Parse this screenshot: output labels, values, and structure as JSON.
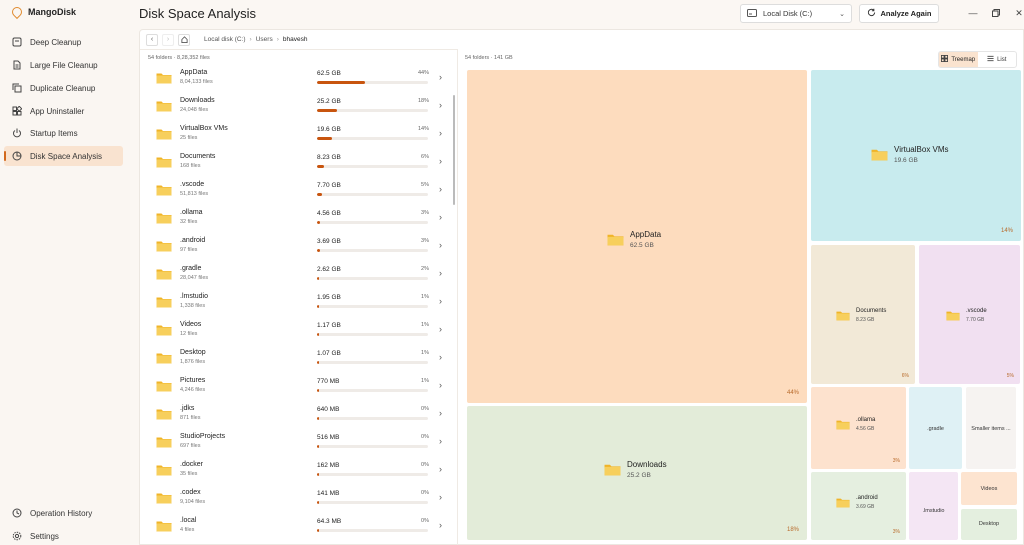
{
  "app": {
    "name": "MangoDisk"
  },
  "sidebar": {
    "items": [
      {
        "label": "Deep Cleanup",
        "icon": "broom-icon"
      },
      {
        "label": "Large File Cleanup",
        "icon": "file-icon"
      },
      {
        "label": "Duplicate Cleanup",
        "icon": "copy-icon"
      },
      {
        "label": "App Uninstaller",
        "icon": "apps-icon"
      },
      {
        "label": "Startup Items",
        "icon": "power-icon"
      },
      {
        "label": "Disk Space Analysis",
        "icon": "pie-chart-icon",
        "active": true
      }
    ],
    "footer": [
      {
        "label": "Operation History",
        "icon": "history-icon"
      },
      {
        "label": "Settings",
        "icon": "gear-icon"
      }
    ]
  },
  "header": {
    "title": "Disk Space Analysis",
    "drive": "Local Disk (C:)",
    "analyze_label": "Analyze Again"
  },
  "breadcrumb": [
    "Local disk (C:)",
    "Users",
    "bhavesh"
  ],
  "list": {
    "summary": "54 folders · 8,28,352 files",
    "rows": [
      {
        "name": "AppData",
        "files": "8,04,133 files",
        "size": "62.5 GB",
        "pct": "44%",
        "pct_value": 44
      },
      {
        "name": "Downloads",
        "files": "24,048 files",
        "size": "25.2 GB",
        "pct": "18%",
        "pct_value": 18
      },
      {
        "name": "VirtualBox VMs",
        "files": "25 files",
        "size": "19.6 GB",
        "pct": "14%",
        "pct_value": 14
      },
      {
        "name": "Documents",
        "files": "168 files",
        "size": "8.23 GB",
        "pct": "6%",
        "pct_value": 6
      },
      {
        "name": ".vscode",
        "files": "51,813 files",
        "size": "7.70 GB",
        "pct": "5%",
        "pct_value": 5
      },
      {
        "name": ".ollama",
        "files": "32 files",
        "size": "4.56 GB",
        "pct": "3%",
        "pct_value": 3
      },
      {
        "name": ".android",
        "files": "97 files",
        "size": "3.69 GB",
        "pct": "3%",
        "pct_value": 3
      },
      {
        "name": ".gradle",
        "files": "28,047 files",
        "size": "2.62 GB",
        "pct": "2%",
        "pct_value": 2
      },
      {
        "name": ".lmstudio",
        "files": "1,338 files",
        "size": "1.95 GB",
        "pct": "1%",
        "pct_value": 1
      },
      {
        "name": "Videos",
        "files": "12 files",
        "size": "1.17 GB",
        "pct": "1%",
        "pct_value": 1
      },
      {
        "name": "Desktop",
        "files": "1,876 files",
        "size": "1.07 GB",
        "pct": "1%",
        "pct_value": 1
      },
      {
        "name": "Pictures",
        "files": "4,246 files",
        "size": "770 MB",
        "pct": "1%",
        "pct_value": 1
      },
      {
        "name": ".jdks",
        "files": "871 files",
        "size": "640 MB",
        "pct": "0%",
        "pct_value": 0.4
      },
      {
        "name": "StudioProjects",
        "files": "697 files",
        "size": "516 MB",
        "pct": "0%",
        "pct_value": 0.3
      },
      {
        "name": ".docker",
        "files": "35 files",
        "size": "162 MB",
        "pct": "0%",
        "pct_value": 0.1
      },
      {
        "name": ".codex",
        "files": "9,104 files",
        "size": "141 MB",
        "pct": "0%",
        "pct_value": 0.1
      },
      {
        "name": ".local",
        "files": "4 files",
        "size": "64.3 MB",
        "pct": "0%",
        "pct_value": 0.05
      }
    ]
  },
  "treemap": {
    "summary": "54 folders · 141 GB",
    "view_options": {
      "treemap": "Treemap",
      "list": "List",
      "active": "treemap"
    },
    "tiles": [
      {
        "id": "appdata",
        "name": "AppData",
        "size": "62.5 GB",
        "pct": "44%",
        "color": "#fddcbe"
      },
      {
        "id": "downloads",
        "name": "Downloads",
        "size": "25.2 GB",
        "pct": "18%",
        "color": "#e3ecd9"
      },
      {
        "id": "virtualbox",
        "name": "VirtualBox VMs",
        "size": "19.6 GB",
        "pct": "14%",
        "color": "#c8ebee"
      },
      {
        "id": "documents",
        "name": "Documents",
        "size": "8.23 GB",
        "pct": "6%",
        "color": "#f2e9d7"
      },
      {
        "id": "vscode",
        "name": ".vscode",
        "size": "7.70 GB",
        "pct": "5%",
        "color": "#f1e0f1"
      },
      {
        "id": "ollama",
        "name": ".ollama",
        "size": "4.56 GB",
        "pct": "3%",
        "color": "#fde2ce"
      },
      {
        "id": "android",
        "name": ".android",
        "size": "3.69 GB",
        "pct": "3%",
        "color": "#e5efe0"
      },
      {
        "id": "gradle",
        "name": ".gradle",
        "color": "#dff1f5"
      },
      {
        "id": "smaller",
        "name": "Smaller items ...",
        "color": "#f6f3f1"
      },
      {
        "id": "lmstudio",
        "name": ".lmstudio",
        "color": "#f4e6f4"
      },
      {
        "id": "videos",
        "name": "Videos",
        "color": "#fde4d0"
      },
      {
        "id": "desktop",
        "name": "Desktop",
        "color": "#e4efdf"
      }
    ]
  },
  "colors": {
    "accent": "#c8550f",
    "folder": "#f5c542",
    "active_nav": "#f9e3d0"
  }
}
